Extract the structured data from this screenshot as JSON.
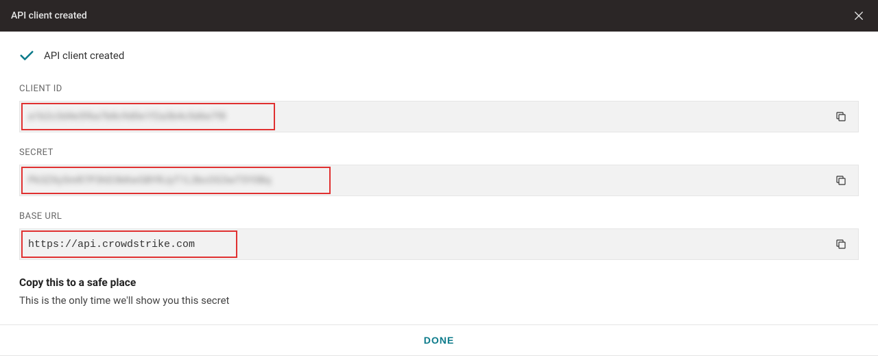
{
  "header": {
    "title": "API client created"
  },
  "success": {
    "message": "API client created"
  },
  "fields": {
    "client_id": {
      "label": "CLIENT ID",
      "value": "a1b2c3d4e5f6a7b8c9d0e1f2a3b4c5d6e7f8"
    },
    "secret": {
      "label": "SECRET",
      "value": "Pk3ZXy5mR7P3hD3kKwGBYRJyT1L3bcOG3wT5Y0Bq"
    },
    "base_url": {
      "label": "BASE URL",
      "value": "https://api.crowdstrike.com"
    }
  },
  "safe": {
    "heading": "Copy this to a safe place",
    "text": "This is the only time we'll show you this secret"
  },
  "footer": {
    "done": "DONE"
  }
}
